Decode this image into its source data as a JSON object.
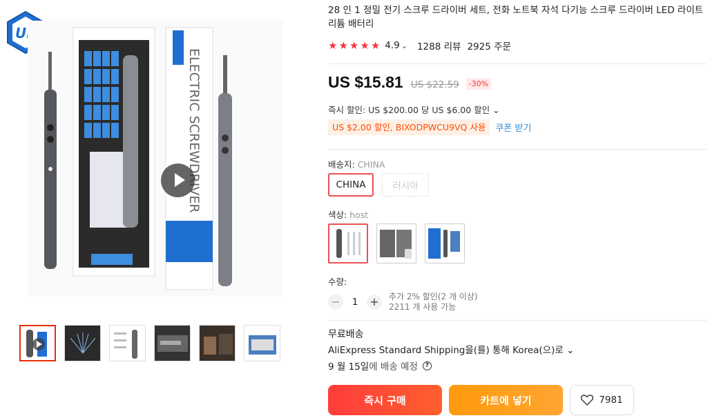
{
  "product": {
    "title": "28 인 1 정밀 전기 스크루 드라이버 세트, 전화 노트북 자석 다기능 스크루 드라이버 LED 라이트 리튬 배터리",
    "rating_value": "4.9",
    "rating_caret": "⌄",
    "reviews": "1288 리뷰",
    "orders": "2925 주문",
    "star_count": 5,
    "star_color": "#f7343c"
  },
  "price": {
    "current": "US $15.81",
    "original": "US $22.59",
    "discount": "-30%"
  },
  "promo": {
    "instant_discount": "즉시 할인: US $200.00 당 US $6.00 할인 ⌄",
    "coupon_code": "US $2.00 할인, BIXODPWCU9VQ 사용",
    "coupon_link": "쿠폰 받기"
  },
  "shipping_from": {
    "label": "배송지: ",
    "value": "CHINA",
    "options": [
      "CHINA",
      "러시아"
    ]
  },
  "color": {
    "label": "색상: ",
    "value": "host",
    "option_count": 3
  },
  "quantity": {
    "label": "수량:",
    "minus": "−",
    "plus": "+",
    "value": "1",
    "bulk_note": "추가 2% 할인(2 개 이상)",
    "available": "2211 개 사용 가능"
  },
  "delivery": {
    "free_shipping": "무료배송",
    "method": "AliExpress Standard Shipping을(를) 통해 Korea(으)로 ⌄",
    "eta_date": "9 월 15일",
    "eta_suffix": "에 배송 예정",
    "help_icon": "?"
  },
  "actions": {
    "buy_now": "즉시 구매",
    "add_to_cart": "카트에 넣기",
    "wishlist_count": "7981"
  },
  "logo_text": "UF",
  "gallery": {
    "thumbnail_count": 6,
    "selected_index": 0
  },
  "colors": {
    "accent": "#ff4747",
    "coupon": "#ff4b00",
    "link": "#2e8dde",
    "cart": "#ff9a0c"
  }
}
